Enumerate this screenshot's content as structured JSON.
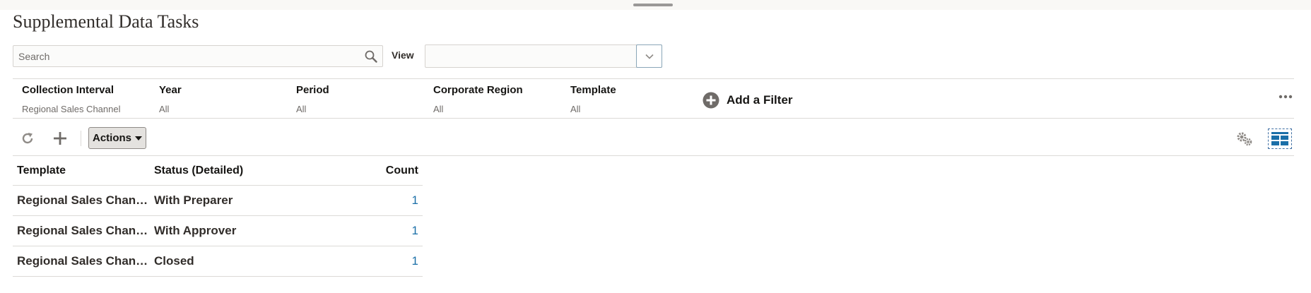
{
  "page": {
    "title": "Supplemental Data Tasks"
  },
  "search": {
    "placeholder": "Search",
    "value": ""
  },
  "view": {
    "label": "View",
    "selected": ""
  },
  "filters": [
    {
      "label": "Collection Interval",
      "value": "Regional Sales Channel"
    },
    {
      "label": "Year",
      "value": "All"
    },
    {
      "label": "Period",
      "value": "All"
    },
    {
      "label": "Corporate Region",
      "value": "All"
    },
    {
      "label": "Template",
      "value": "All"
    }
  ],
  "add_filter": {
    "label": "Add a Filter"
  },
  "toolbar": {
    "actions_label": "Actions",
    "icons": [
      "refresh-icon",
      "plus-icon",
      "gear-icon",
      "layout-icon"
    ]
  },
  "table": {
    "headers": {
      "template": "Template",
      "status": "Status (Detailed)",
      "count": "Count"
    },
    "rows": [
      {
        "template": "Regional Sales Channel",
        "status": "With Preparer",
        "count": "1"
      },
      {
        "template": "Regional Sales Channel",
        "status": "With Approver",
        "count": "1"
      },
      {
        "template": "Regional Sales Channel",
        "status": "Closed",
        "count": "1"
      }
    ]
  },
  "colors": {
    "accent": "#1b6fa8",
    "text": "#161513",
    "border": "#dcdad7"
  }
}
